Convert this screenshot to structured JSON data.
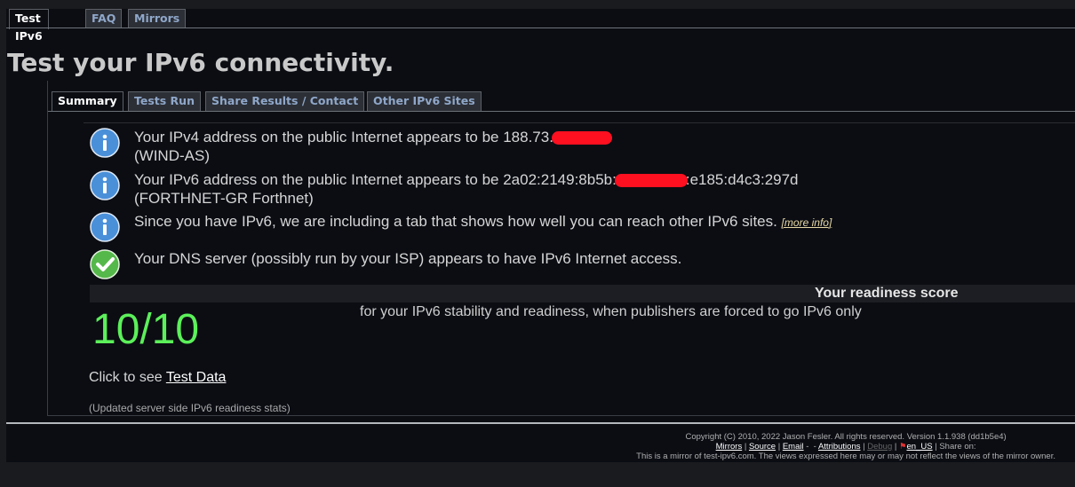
{
  "top_tabs": [
    "Test IPv6",
    "FAQ",
    "Mirrors"
  ],
  "title": "Test your IPv6 connectivity.",
  "inner_tabs": [
    "Summary",
    "Tests Run",
    "Share Results / Contact",
    "Other IPv6 Sites"
  ],
  "messages": {
    "ipv4_line1_prefix": "Your IPv4 address on the public Internet appears to be 188.73.",
    "ipv4_line2": "(WIND-AS)",
    "ipv6_line1_prefix": "Your IPv6 address on the public Internet appears to be 2a02:2149:8b5b:",
    "ipv6_line1_suffix": ":e185:d4c3:297d",
    "ipv6_line2": "(FORTHNET-GR Forthnet)",
    "tab_notice": "Since you have IPv6, we are including a tab that shows how well you can reach other IPv6 sites.",
    "more_info": "[more info]",
    "dns": "Your DNS server (possibly run by your ISP) appears to have IPv6 Internet access."
  },
  "score": {
    "label": "Your readiness score",
    "value": "10/10",
    "description": "for your IPv6 stability and readiness, when publishers are forced to go IPv6 only"
  },
  "test_data": {
    "prefix": "Click to see",
    "link": "Test Data"
  },
  "updated_stats": "(Updated server side IPv6 readiness stats)",
  "footer": {
    "copyright": "Copyright (C) 2010, 2022 Jason Fesler. All rights reserved. Version 1.1.938 (dd1b5e4)",
    "links": [
      "Mirrors",
      "Source",
      "Email",
      "Attributions",
      "Debug",
      "en_US"
    ],
    "share": "Share on:",
    "mirror_note": "This is a mirror of test-ipv6.com. The views expressed here may or may not reflect the views of the mirror owner."
  },
  "colors": {
    "score_green": "#5cf05a",
    "info_blue": "#4a90d9",
    "check_green": "#55b84a",
    "redaction": "#ff1020"
  }
}
